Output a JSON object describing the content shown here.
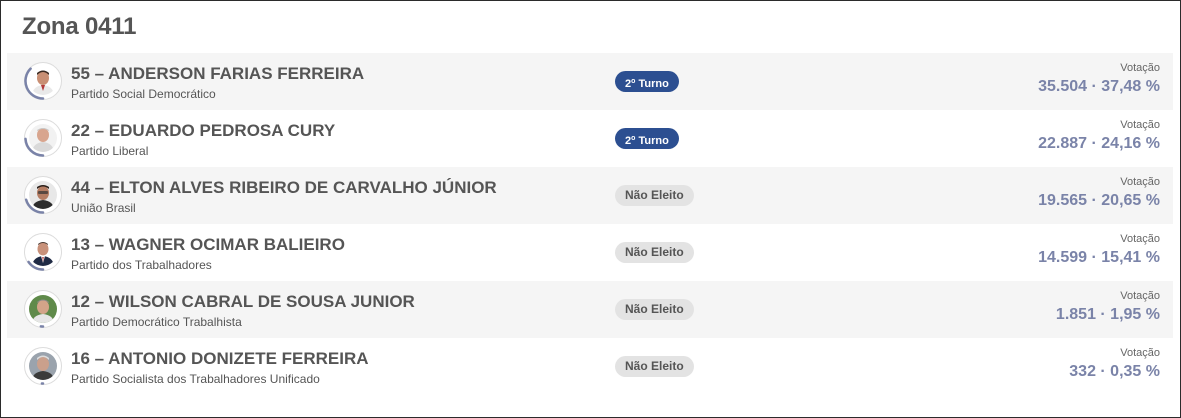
{
  "zone": {
    "title": "Zona 0411"
  },
  "colors": {
    "turno_badge": "#2c4f91",
    "nao_eleito_badge": "#e3e3e3",
    "votes_value": "#7a83a8",
    "arc": "#7a83a8"
  },
  "votes_label": "Votação",
  "candidates": [
    {
      "name": "55 – ANDERSON FARIAS FERREIRA",
      "party": "Partido Social Democrático",
      "status_kind": "turno",
      "status_prefix": "2",
      "status_sup": "o",
      "status_suffix": " Turno",
      "votes": "35.504 · 37,48 %",
      "vote_share": 0.3748
    },
    {
      "name": "22 – EDUARDO PEDROSA CURY",
      "party": "Partido Liberal",
      "status_kind": "turno",
      "status_prefix": "2",
      "status_sup": "o",
      "status_suffix": " Turno",
      "votes": "22.887 · 24,16 %",
      "vote_share": 0.2416
    },
    {
      "name": "44 – ELTON ALVES RIBEIRO DE CARVALHO JÚNIOR",
      "party": "União Brasil",
      "status_kind": "neleito",
      "status_text": "Não Eleito",
      "votes": "19.565 · 20,65 %",
      "vote_share": 0.2065
    },
    {
      "name": "13 – WAGNER OCIMAR BALIEIRO",
      "party": "Partido dos Trabalhadores",
      "status_kind": "neleito",
      "status_text": "Não Eleito",
      "votes": "14.599 · 15,41 %",
      "vote_share": 0.1541
    },
    {
      "name": "12 – WILSON CABRAL DE SOUSA JUNIOR",
      "party": "Partido Democrático Trabalhista",
      "status_kind": "neleito",
      "status_text": "Não Eleito",
      "votes": "1.851 · 1,95 %",
      "vote_share": 0.0195
    },
    {
      "name": "16 – ANTONIO DONIZETE FERREIRA",
      "party": "Partido Socialista dos Trabalhadores Unificado",
      "status_kind": "neleito",
      "status_text": "Não Eleito",
      "votes": "332 · 0,35 %",
      "vote_share": 0.0035
    }
  ]
}
